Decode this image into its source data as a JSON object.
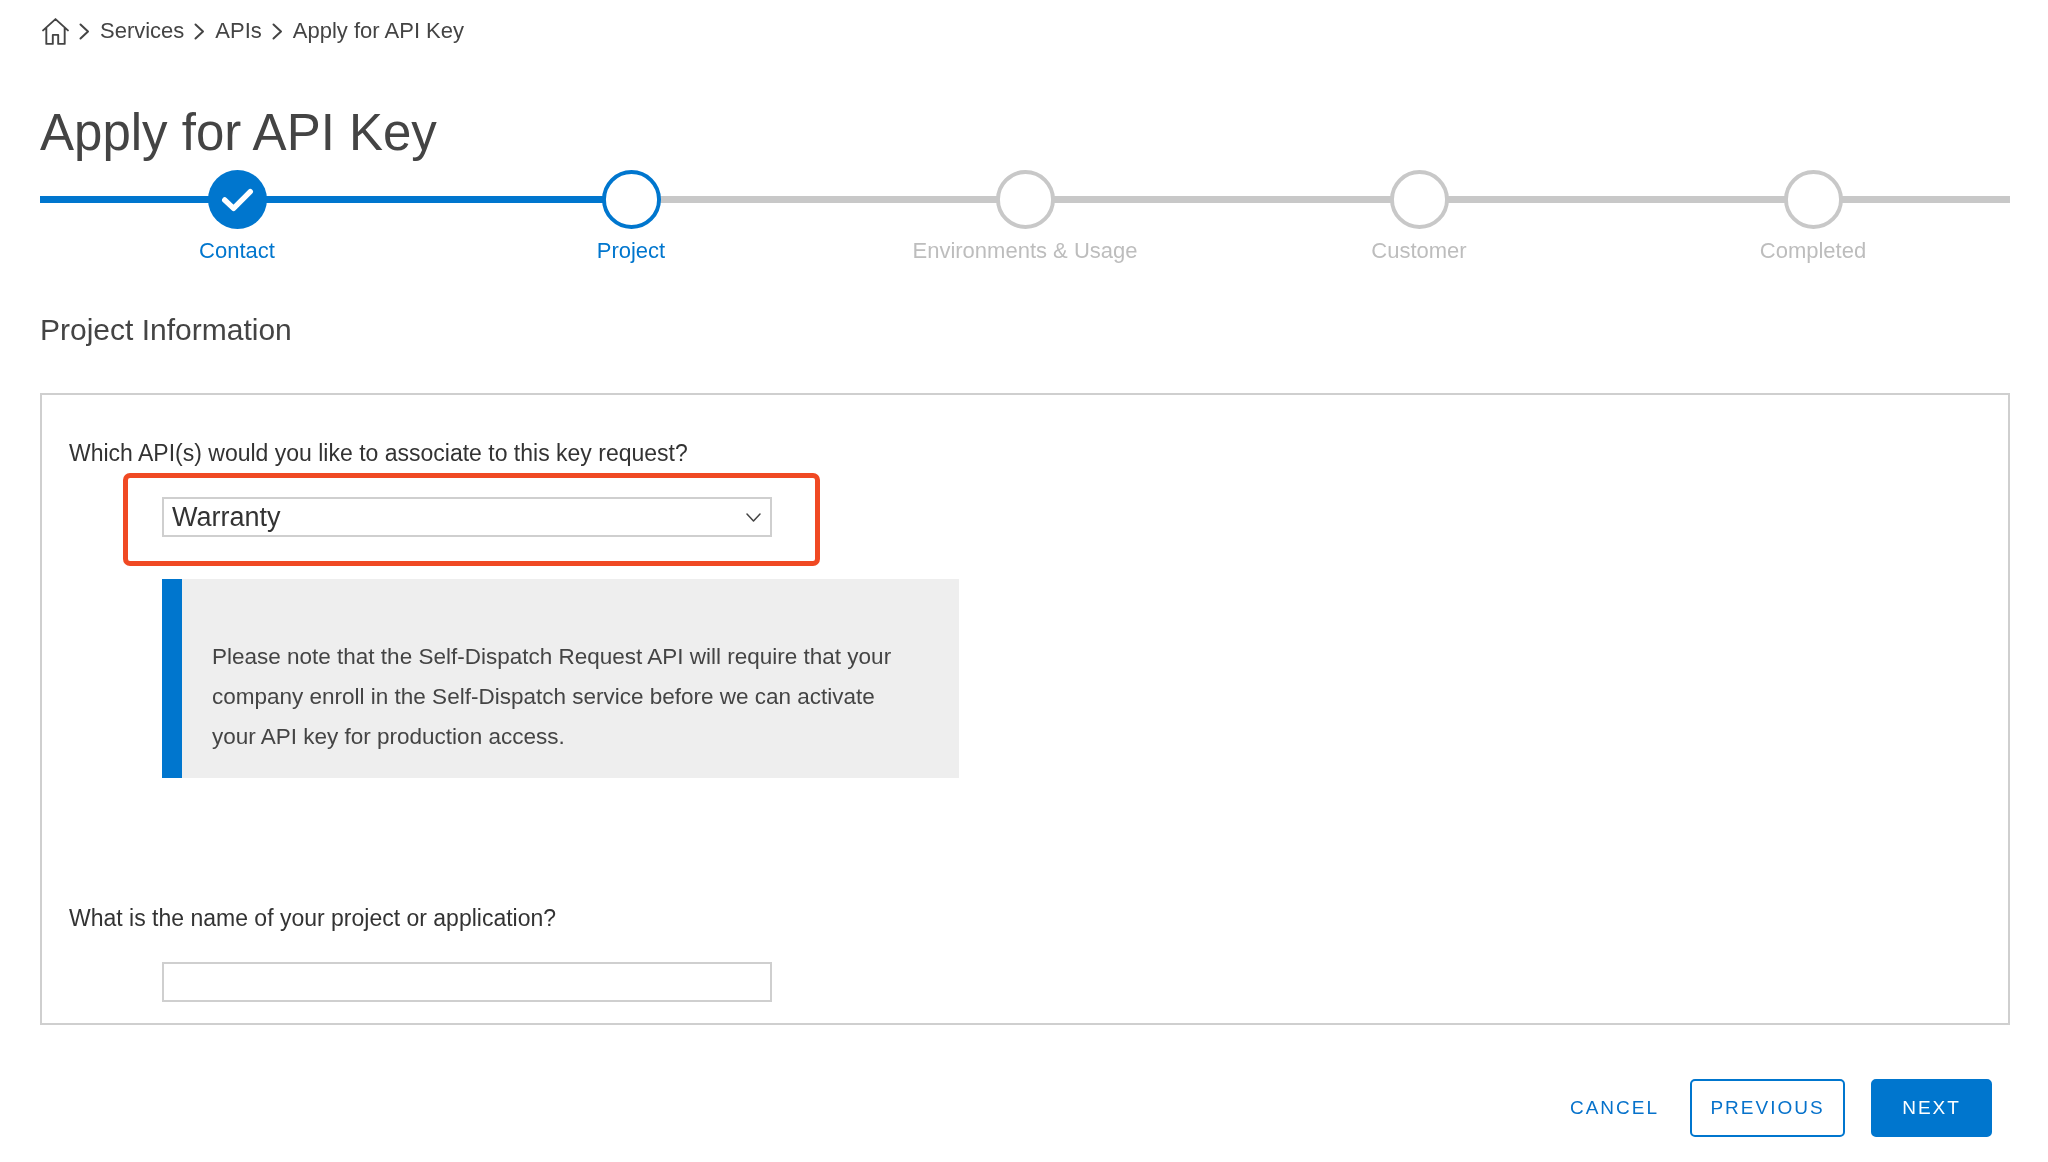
{
  "breadcrumb": [
    {
      "label": "Services"
    },
    {
      "label": "APIs"
    },
    {
      "label": "Apply for API Key"
    }
  ],
  "title": "Apply for API Key",
  "stepper": {
    "level": 0.3,
    "steps": [
      {
        "label": "Contact",
        "completed": true,
        "selected": false
      },
      {
        "label": "Project",
        "completed": false,
        "selected": true
      },
      {
        "label": "Environments & Usage",
        "completed": false,
        "selected": false
      },
      {
        "label": "Customer",
        "completed": false,
        "selected": false
      },
      {
        "label": "Completed",
        "completed": false,
        "selected": false
      }
    ]
  },
  "section_title": "Project Information",
  "form": {
    "fields": [
      {
        "kind": "select",
        "label": "Which API(s) would you like to associate to this key request?",
        "value": "Warranty",
        "highlighted": true,
        "note": "Please note that the Self-Dispatch Request API will require that your company enroll in the Self-Dispatch service before we can activate your API key for production access."
      },
      {
        "kind": "text",
        "label": "What is the name of your project or application?"
      }
    ]
  },
  "buttons": [
    {
      "label": "CANCEL",
      "kind": "text"
    },
    {
      "label": "PREVIOUS",
      "kind": "outline"
    },
    {
      "label": "NEXT",
      "kind": "primary"
    }
  ]
}
